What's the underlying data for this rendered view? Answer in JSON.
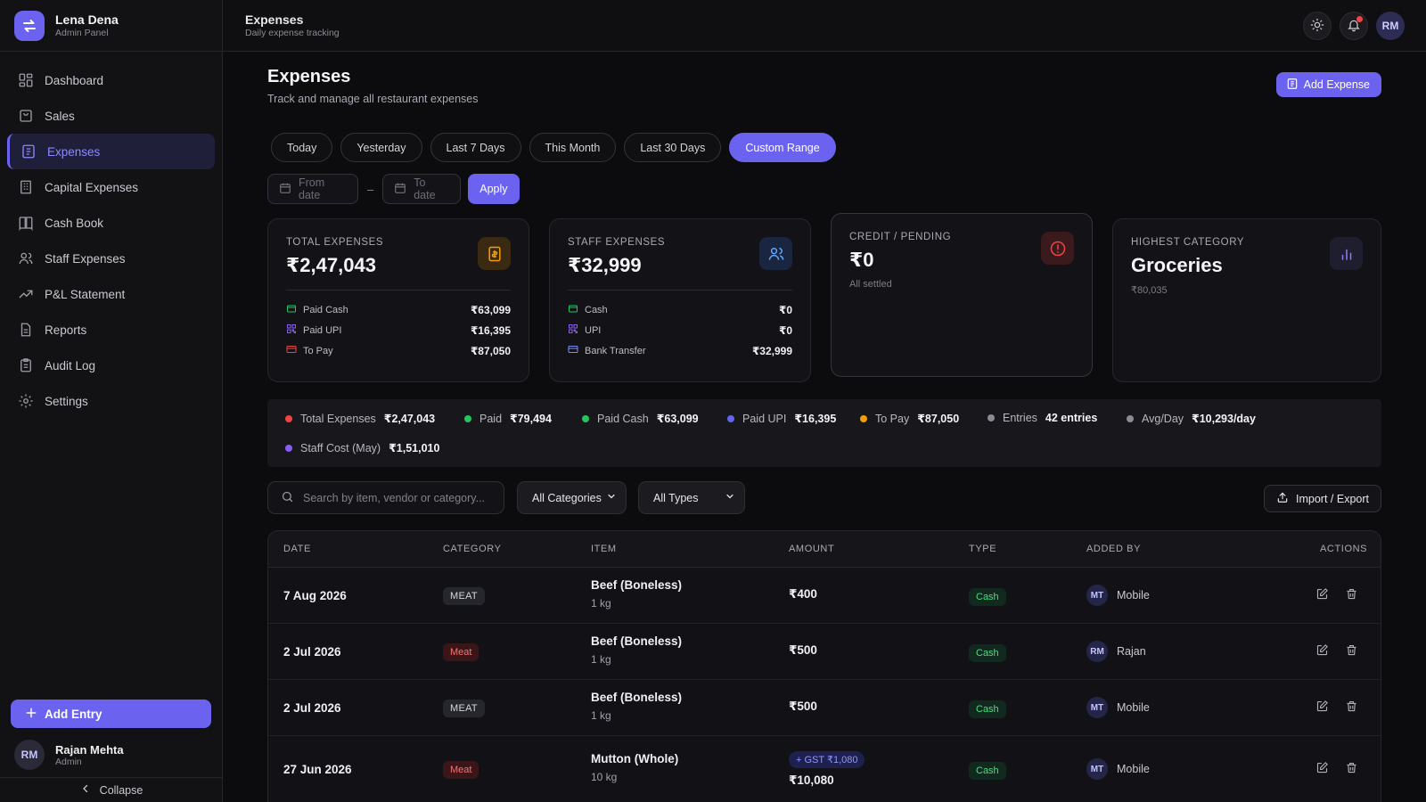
{
  "brand": {
    "name": "Lena Dena",
    "sub": "Admin Panel"
  },
  "sidebar": {
    "items": [
      {
        "label": "Dashboard"
      },
      {
        "label": "Sales"
      },
      {
        "label": "Expenses"
      },
      {
        "label": "Capital Expenses"
      },
      {
        "label": "Cash Book"
      },
      {
        "label": "Staff Expenses"
      },
      {
        "label": "P&L Statement"
      },
      {
        "label": "Reports"
      },
      {
        "label": "Audit Log"
      },
      {
        "label": "Settings"
      }
    ],
    "add_entry": "Add Entry",
    "profile": {
      "initials": "RM",
      "name": "Rajan Mehta",
      "role": "Admin"
    },
    "collapse": "Collapse"
  },
  "topbar": {
    "title": "Expenses",
    "subtitle": "Daily expense tracking",
    "avatar": "RM"
  },
  "page": {
    "title": "Expenses",
    "subtitle": "Track and manage all restaurant expenses",
    "add_button": "Add Expense"
  },
  "filters": {
    "chips": [
      "Today",
      "Yesterday",
      "Last 7 Days",
      "This Month",
      "Last 30 Days",
      "Custom Range"
    ],
    "from_placeholder": "From date",
    "to_placeholder": "To date",
    "separator": "–",
    "apply": "Apply"
  },
  "cards": {
    "total": {
      "label": "TOTAL EXPENSES",
      "value": "₹2,47,043",
      "rows": [
        {
          "label": "Paid Cash",
          "value": "₹63,099"
        },
        {
          "label": "Paid UPI",
          "value": "₹16,395"
        },
        {
          "label": "To Pay",
          "value": "₹87,050"
        }
      ]
    },
    "staff": {
      "label": "STAFF EXPENSES",
      "value": "₹32,999",
      "rows": [
        {
          "label": "Cash",
          "value": "₹0"
        },
        {
          "label": "UPI",
          "value": "₹0"
        },
        {
          "label": "Bank Transfer",
          "value": "₹32,999"
        }
      ]
    },
    "credit": {
      "label": "CREDIT / PENDING",
      "value": "₹0",
      "note": "All settled"
    },
    "highest": {
      "label": "HIGHEST CATEGORY",
      "value": "Groceries",
      "note": "₹80,035"
    }
  },
  "summary": [
    {
      "label": "Total Expenses",
      "value": "₹2,47,043",
      "color": "#ef4444"
    },
    {
      "label": "Paid",
      "value": "₹79,494",
      "color": "#22c55e"
    },
    {
      "label": "Paid Cash",
      "value": "₹63,099",
      "color": "#22c55e"
    },
    {
      "label": "Paid UPI",
      "value": "₹16,395",
      "color": "#6366f1"
    },
    {
      "label": "To Pay",
      "value": "₹87,050",
      "color": "#f59e0b"
    },
    {
      "label": "Entries",
      "value": "42 entries",
      "color": "#8b8b95"
    },
    {
      "label": "Avg/Day",
      "value": "₹10,293/day",
      "color": "#8b8b95"
    },
    {
      "label": "Staff Cost (May)",
      "value": "₹1,51,010",
      "color": "#8b5cf6"
    }
  ],
  "toolbar": {
    "search_placeholder": "Search by item, vendor or category...",
    "category_select": "All Categories",
    "type_select": "All Types",
    "import_export": "Import / Export"
  },
  "table": {
    "headers": [
      "DATE",
      "CATEGORY",
      "ITEM",
      "AMOUNT",
      "TYPE",
      "ADDED BY",
      "ACTIONS"
    ],
    "rows": [
      {
        "date": "7 Aug 2026",
        "category": "MEAT",
        "item": "Beef (Boneless)",
        "qty": "1 kg",
        "amount": "₹400",
        "gst": "",
        "type": "Cash",
        "initials": "MT",
        "added_by": "Mobile"
      },
      {
        "date": "2 Jul 2026",
        "category": "Meat",
        "item": "Beef (Boneless)",
        "qty": "1 kg",
        "amount": "₹500",
        "gst": "",
        "type": "Cash",
        "initials": "RM",
        "added_by": "Rajan"
      },
      {
        "date": "2 Jul 2026",
        "category": "MEAT",
        "item": "Beef (Boneless)",
        "qty": "1 kg",
        "amount": "₹500",
        "gst": "",
        "type": "Cash",
        "initials": "MT",
        "added_by": "Mobile"
      },
      {
        "date": "27 Jun 2026",
        "category": "Meat",
        "item": "Mutton (Whole)",
        "qty": "10 kg",
        "amount": "₹10,080",
        "gst": "+ GST ₹1,080",
        "type": "Cash",
        "initials": "MT",
        "added_by": "Mobile"
      }
    ]
  }
}
